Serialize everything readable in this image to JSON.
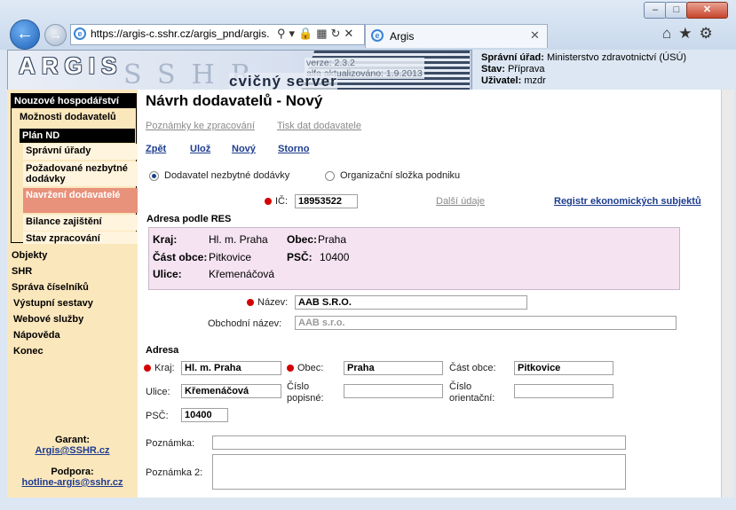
{
  "browser": {
    "url": "https://argis-c.sshr.cz/argis_pnd/argis.",
    "tab_title": "Argis",
    "window_buttons": [
      "–",
      "□",
      "✕"
    ]
  },
  "header": {
    "logo": "ARGIS",
    "logo_bg": "SSHR",
    "version": "verze: 2.3.2",
    "updated": "alfa aktualizováno: 1.9.2013",
    "server": "cvičný server",
    "office_label": "Správní úřad:",
    "office_value": "Ministerstvo zdravotnictví (ÚSÚ)",
    "state_label": "Stav:",
    "state_value": "Příprava",
    "user_label": "Uživatel:",
    "user_value": "mzdr"
  },
  "sidebar": {
    "section1": "Nouzové hospodářství",
    "item_moznosti": "Možnosti dodavatelů",
    "section2": "Plán ND",
    "sub": [
      "Správní úřady",
      "Požadované nezbytné dodávky",
      "Navržení dodavatelé",
      "Bilance zajištění",
      "Stav zpracování"
    ],
    "top": [
      "Objekty",
      "SHR",
      "Správa číselníků",
      "Výstupní sestavy",
      "Webové služby",
      "Nápověda",
      "Konec"
    ],
    "garant_label": "Garant:",
    "garant_email": "Argis@SSHR.cz",
    "support_label": "Podpora:",
    "support_email": "hotline-argis@sshr.cz"
  },
  "main": {
    "title": "Návrh dodavatelů - Nový",
    "link_notes": "Poznámky ke zpracování",
    "link_print": "Tisk dat dodavatele",
    "actions": [
      "Zpět",
      "Ulož",
      "Nový",
      "Storno"
    ],
    "radio1": "Dodavatel nezbytné dodávky",
    "radio2": "Organizační složka podniku",
    "ic_label": "IČ:",
    "ic_value": "18953522",
    "more_data": "Další údaje",
    "registry": "Registr ekonomických subjektů",
    "res_title": "Adresa podle RES",
    "res": {
      "kraj_label": "Kraj:",
      "kraj_value": "Hl. m. Praha",
      "obec_label": "Obec:",
      "obec_value": "Praha",
      "cast_label": "Část obce:",
      "cast_value": "Pitkovice",
      "psc_label": "PSČ:",
      "psc_value": "10400",
      "ulice_label": "Ulice:",
      "ulice_value": "Křemenáčová"
    },
    "name_label": "Název:",
    "name_value": "AAB S.R.O.",
    "trade_label": "Obchodní název:",
    "trade_value": "AAB s.r.o.",
    "addr_title": "Adresa",
    "kraj_label": "Kraj:",
    "kraj_value": "Hl. m. Praha",
    "obec_label": "Obec:",
    "obec_value": "Praha",
    "cast_label": "Část obce:",
    "cast_value": "Pitkovice",
    "ulice_label": "Ulice:",
    "ulice_value": "Křemenáčová",
    "cp_label1": "Číslo",
    "cp_label2": "popisné:",
    "co_label1": "Číslo",
    "co_label2": "orientační:",
    "psc_label": "PSČ:",
    "psc_value": "10400",
    "note_label": "Poznámka:",
    "note2_label": "Poznámka 2:"
  },
  "colors": {
    "sidebar_bg": "#fbe7bc",
    "active_item": "#e8917b",
    "res_box": "#f5e3f2",
    "required_dot": "#d40000",
    "link": "#1d3c8f"
  }
}
